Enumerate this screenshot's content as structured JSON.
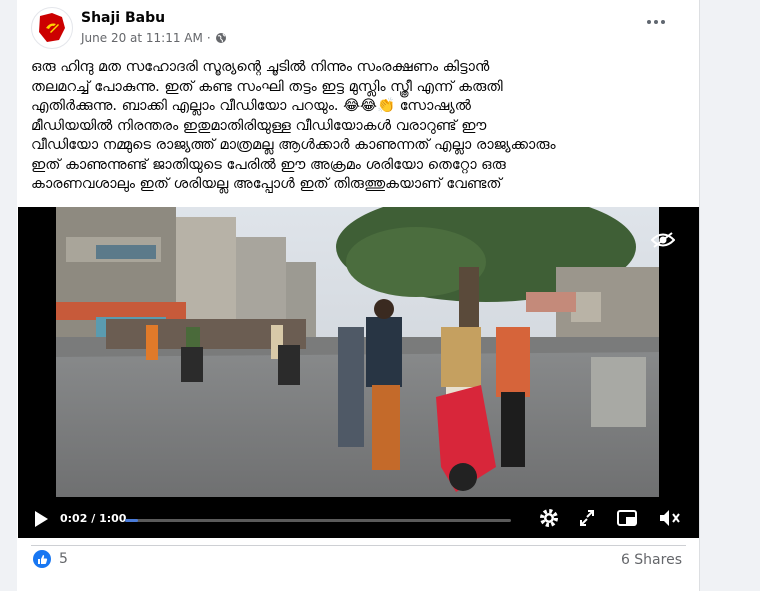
{
  "post": {
    "author": "Shaji Babu",
    "timestamp": "June 20 at 11:11 AM",
    "separator": "·",
    "text": "ഒരു ഹിന്ദു മത സഹോദരി സൂര്യന്റെ ചൂടിൽ നിന്നും സംരക്ഷണം കിട്ടാൻ\nതലമറച്ച് പോകുന്നു. ഇത് കണ്ട സംഘി തട്ടം ഇട്ട മുസ്ലിം സ്ത്രീ എന്ന് കരുതി\nഎതിർക്കുന്നു. ബാക്കി എല്ലാം വീഡിയോ പറയും. 😂😂👏 സോഷ്യൽ\nമീഡിയയിൽ നിരന്തരം ഇതുമാതിരിയുള്ള വീഡിയോകൾ വരാറുണ്ട് ഈ\nവീഡിയോ നമ്മുടെ രാജ്യത്ത് മാത്രമല്ല ആൾക്കാർ കാണുന്നത് എല്ലാ രാജ്യക്കാരും\nഇത് കാണുന്നുണ്ട് ജാതിയുടെ പേരിൽ ഈ അക്രമം ശരിയോ തെറ്റോ ഒരു\nകാരണവശാലും ഇത് ശരിയല്ല അപ്പോൾ ഇത് തിരുത്തുകയാണ് വേണ്ടത്"
  },
  "video": {
    "current_time": "0:02",
    "duration": "1:00",
    "time_display": "0:02 / 1:00",
    "progress_fraction": 0.033
  },
  "footer": {
    "reaction_count": "5",
    "shares": "6 Shares"
  },
  "icons": {
    "privacy": "globe-icon",
    "more": "more-options-icon",
    "visibility": "eye-icon",
    "play": "play-icon",
    "settings": "gear-icon",
    "fullscreen": "expand-icon",
    "pip": "picture-in-picture-icon",
    "volume": "volume-icon",
    "reaction": "like-icon"
  },
  "colors": {
    "brand": "#1877f2",
    "progress": "#4a7bd8",
    "avatar_flag": "#cc0000"
  }
}
